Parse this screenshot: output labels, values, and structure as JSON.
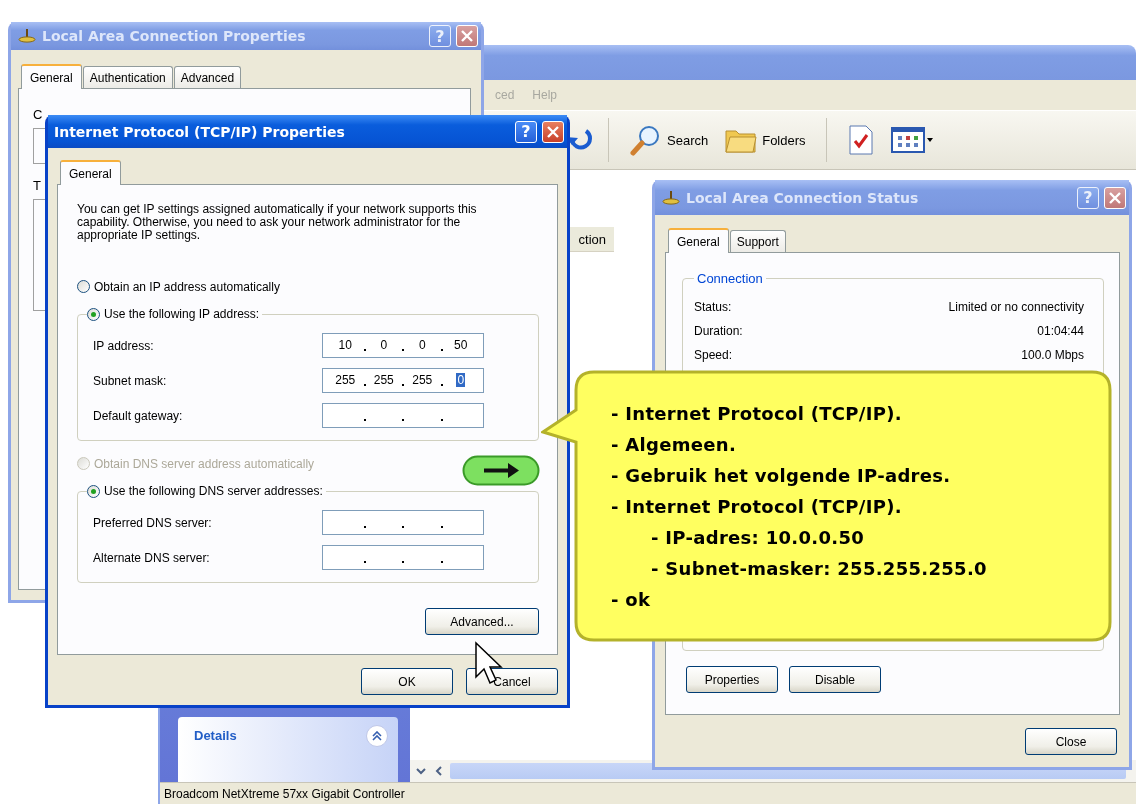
{
  "explorer": {
    "menu": [
      "ced",
      "Help"
    ],
    "toolbar": [
      {
        "kind": "back"
      },
      {
        "kind": "search",
        "label": "Search"
      },
      {
        "kind": "folders",
        "label": "Folders"
      },
      {
        "kind": "tasks"
      },
      {
        "kind": "views"
      }
    ],
    "column_header": "ction",
    "details_panel": {
      "title": "Details",
      "expanded": true
    },
    "status_bar": "Broadcom NetXtreme 57xx Gigabit Controller"
  },
  "lac_properties": {
    "title": "Local Area Connection Properties",
    "active": false,
    "help": "?",
    "tabs": [
      {
        "label": "General",
        "selected": true
      },
      {
        "label": "Authentication",
        "selected": false
      },
      {
        "label": "Advanced",
        "selected": false
      }
    ],
    "labels": [
      "C",
      "T"
    ]
  },
  "tcpip_properties": {
    "title": "Internet Protocol (TCP/IP) Properties",
    "active": true,
    "help": "?",
    "tabs": [
      {
        "label": "General",
        "selected": true
      }
    ],
    "intro": "You can get IP settings assigned automatically if your network supports this capability. Otherwise, you need to ask your network administrator for the appropriate IP settings.",
    "ip_options": [
      {
        "label": "Obtain an IP address automatically",
        "selected": false,
        "disabled": false
      },
      {
        "label": "Use the following IP address:",
        "selected": true,
        "disabled": false
      }
    ],
    "ip_fields": [
      {
        "label": "IP address:",
        "octets": [
          {
            "text": "10",
            "selected": false
          },
          {
            "text": "0",
            "selected": false
          },
          {
            "text": "0",
            "selected": false
          },
          {
            "text": "50",
            "selected": false
          }
        ]
      },
      {
        "label": "Subnet mask:",
        "octets": [
          {
            "text": "255",
            "selected": false
          },
          {
            "text": "255",
            "selected": false
          },
          {
            "text": "255",
            "selected": false
          },
          {
            "text": "0",
            "selected": true
          }
        ]
      },
      {
        "label": "Default gateway:"
      }
    ],
    "dns_options": [
      {
        "label": "Obtain DNS server address automatically",
        "selected": false,
        "disabled": true
      },
      {
        "label": "Use the following DNS server addresses:",
        "selected": true,
        "disabled": false
      }
    ],
    "dns_fields": [
      {
        "label": "Preferred DNS server:"
      },
      {
        "label": "Alternate DNS server:"
      }
    ],
    "advanced_button": "Advanced...",
    "buttons": [
      "OK",
      "Cancel"
    ]
  },
  "status_window": {
    "title": "Local Area Connection Status",
    "active": false,
    "help": "?",
    "tabs": [
      {
        "label": "General",
        "selected": true
      },
      {
        "label": "Support",
        "selected": false
      }
    ],
    "group": "Connection",
    "rows": [
      {
        "label": "Status:",
        "value": "Limited or no connectivity"
      },
      {
        "label": "Duration:",
        "value": "01:04:44"
      },
      {
        "label": "Speed:",
        "value": "100.0 Mbps"
      }
    ],
    "buttons": [
      "Properties",
      "Disable"
    ],
    "close_button": "Close"
  },
  "callout": {
    "lines": [
      {
        "text": "- Internet Protocol (TCP/IP)."
      },
      {
        "text": "- Algemeen."
      },
      {
        "text": "- Gebruik het volgende IP-adres."
      },
      {
        "text": "- Internet Protocol (TCP/IP).",
        "children": [
          {
            "text": "- IP-adres: 10.0.0.50"
          },
          {
            "text": "- Subnet-masker: 255.255.255.0"
          }
        ]
      },
      {
        "text": "- ok"
      }
    ]
  }
}
